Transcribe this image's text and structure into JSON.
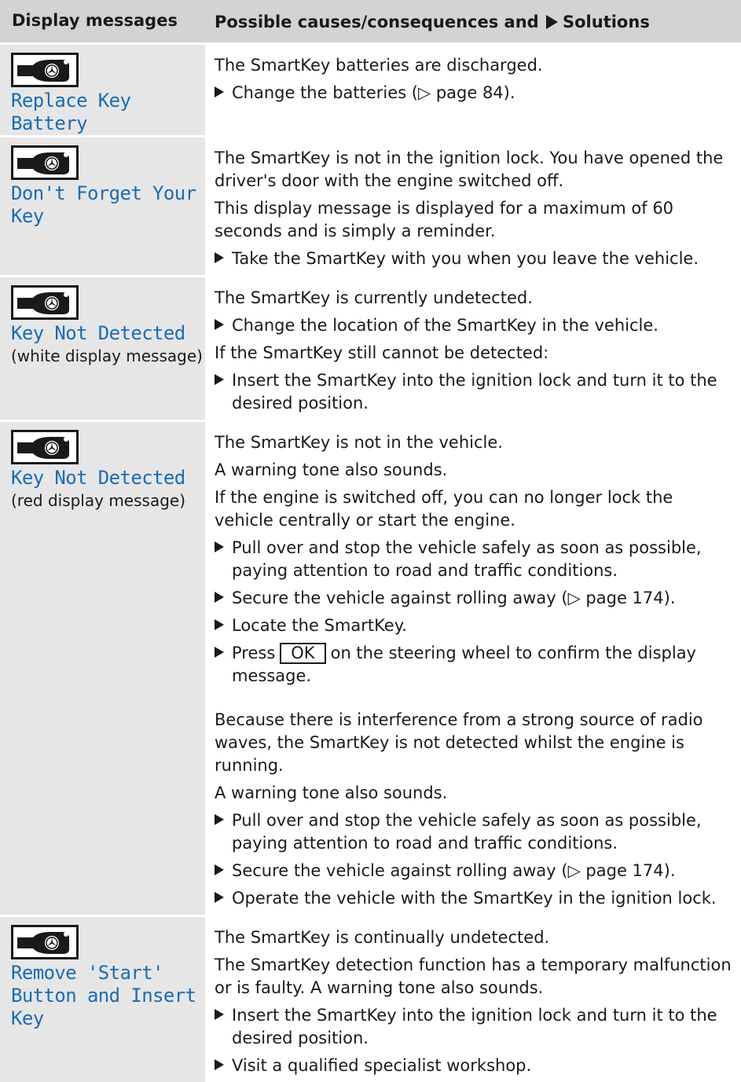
{
  "header": {
    "col1": "Display messages",
    "col2_prefix": "Possible causes/consequences and",
    "col2_suffix": "Solutions"
  },
  "icons": {
    "key": "smartkey-display-icon"
  },
  "rows": [
    {
      "message": "Replace Key Battery",
      "note": "",
      "items": [
        {
          "kind": "text",
          "text": "The SmartKey batteries are discharged."
        },
        {
          "kind": "step",
          "text": "Change the batteries (▷ page 84)."
        }
      ]
    },
    {
      "message": "Don't Forget Your Key",
      "note": "",
      "items": [
        {
          "kind": "text",
          "text": "The SmartKey is not in the ignition lock. You have opened the driver's door with the engine switched off."
        },
        {
          "kind": "text",
          "text": "This display message is displayed for a maximum of 60 seconds and is simply a reminder."
        },
        {
          "kind": "step",
          "text": "Take the SmartKey with you when you leave the vehicle."
        }
      ]
    },
    {
      "message": "Key Not Detected",
      "note": "(white display message)",
      "items": [
        {
          "kind": "text",
          "text": "The SmartKey is currently undetected."
        },
        {
          "kind": "step",
          "text": "Change the location of the SmartKey in the vehicle."
        },
        {
          "kind": "text",
          "text": "If the SmartKey still cannot be detected:"
        },
        {
          "kind": "step",
          "text": "Insert the SmartKey into the ignition lock and turn it to the desired position."
        }
      ]
    },
    {
      "message": "Key Not Detected",
      "note": "(red display message)",
      "items": [
        {
          "kind": "text",
          "text": "The SmartKey is not in the vehicle."
        },
        {
          "kind": "text",
          "text": "A warning tone also sounds."
        },
        {
          "kind": "text",
          "text": "If the engine is switched off, you can no longer lock the vehicle centrally or start the engine."
        },
        {
          "kind": "step",
          "text": "Pull over and stop the vehicle safely as soon as possible, paying attention to road and traffic conditions."
        },
        {
          "kind": "step",
          "text": "Secure the vehicle against rolling away (▷ page 174)."
        },
        {
          "kind": "step",
          "text": "Locate the SmartKey."
        },
        {
          "kind": "step_ok",
          "before": "Press",
          "button": "OK",
          "after": "on the steering wheel to confirm the display message."
        }
      ],
      "sub_items": [
        {
          "kind": "text",
          "text": "Because there is interference from a strong source of radio waves, the SmartKey is not detected whilst the engine is running."
        },
        {
          "kind": "text",
          "text": "A warning tone also sounds."
        },
        {
          "kind": "step",
          "text": "Pull over and stop the vehicle safely as soon as possible, paying attention to road and traffic conditions."
        },
        {
          "kind": "step",
          "text": "Secure the vehicle against rolling away (▷ page 174)."
        },
        {
          "kind": "step",
          "text": "Operate the vehicle with the SmartKey in the ignition lock."
        }
      ]
    },
    {
      "message": "Remove 'Start' Button and Insert Key",
      "note": "",
      "items": [
        {
          "kind": "text",
          "text": "The SmartKey is continually undetected."
        },
        {
          "kind": "text",
          "text": "The SmartKey detection function has a temporary malfunction or is faulty. A warning tone also sounds."
        },
        {
          "kind": "step",
          "text": "Insert the SmartKey into the ignition lock and turn it to the desired position."
        },
        {
          "kind": "step",
          "text": "Visit a qualified specialist workshop."
        }
      ]
    }
  ]
}
